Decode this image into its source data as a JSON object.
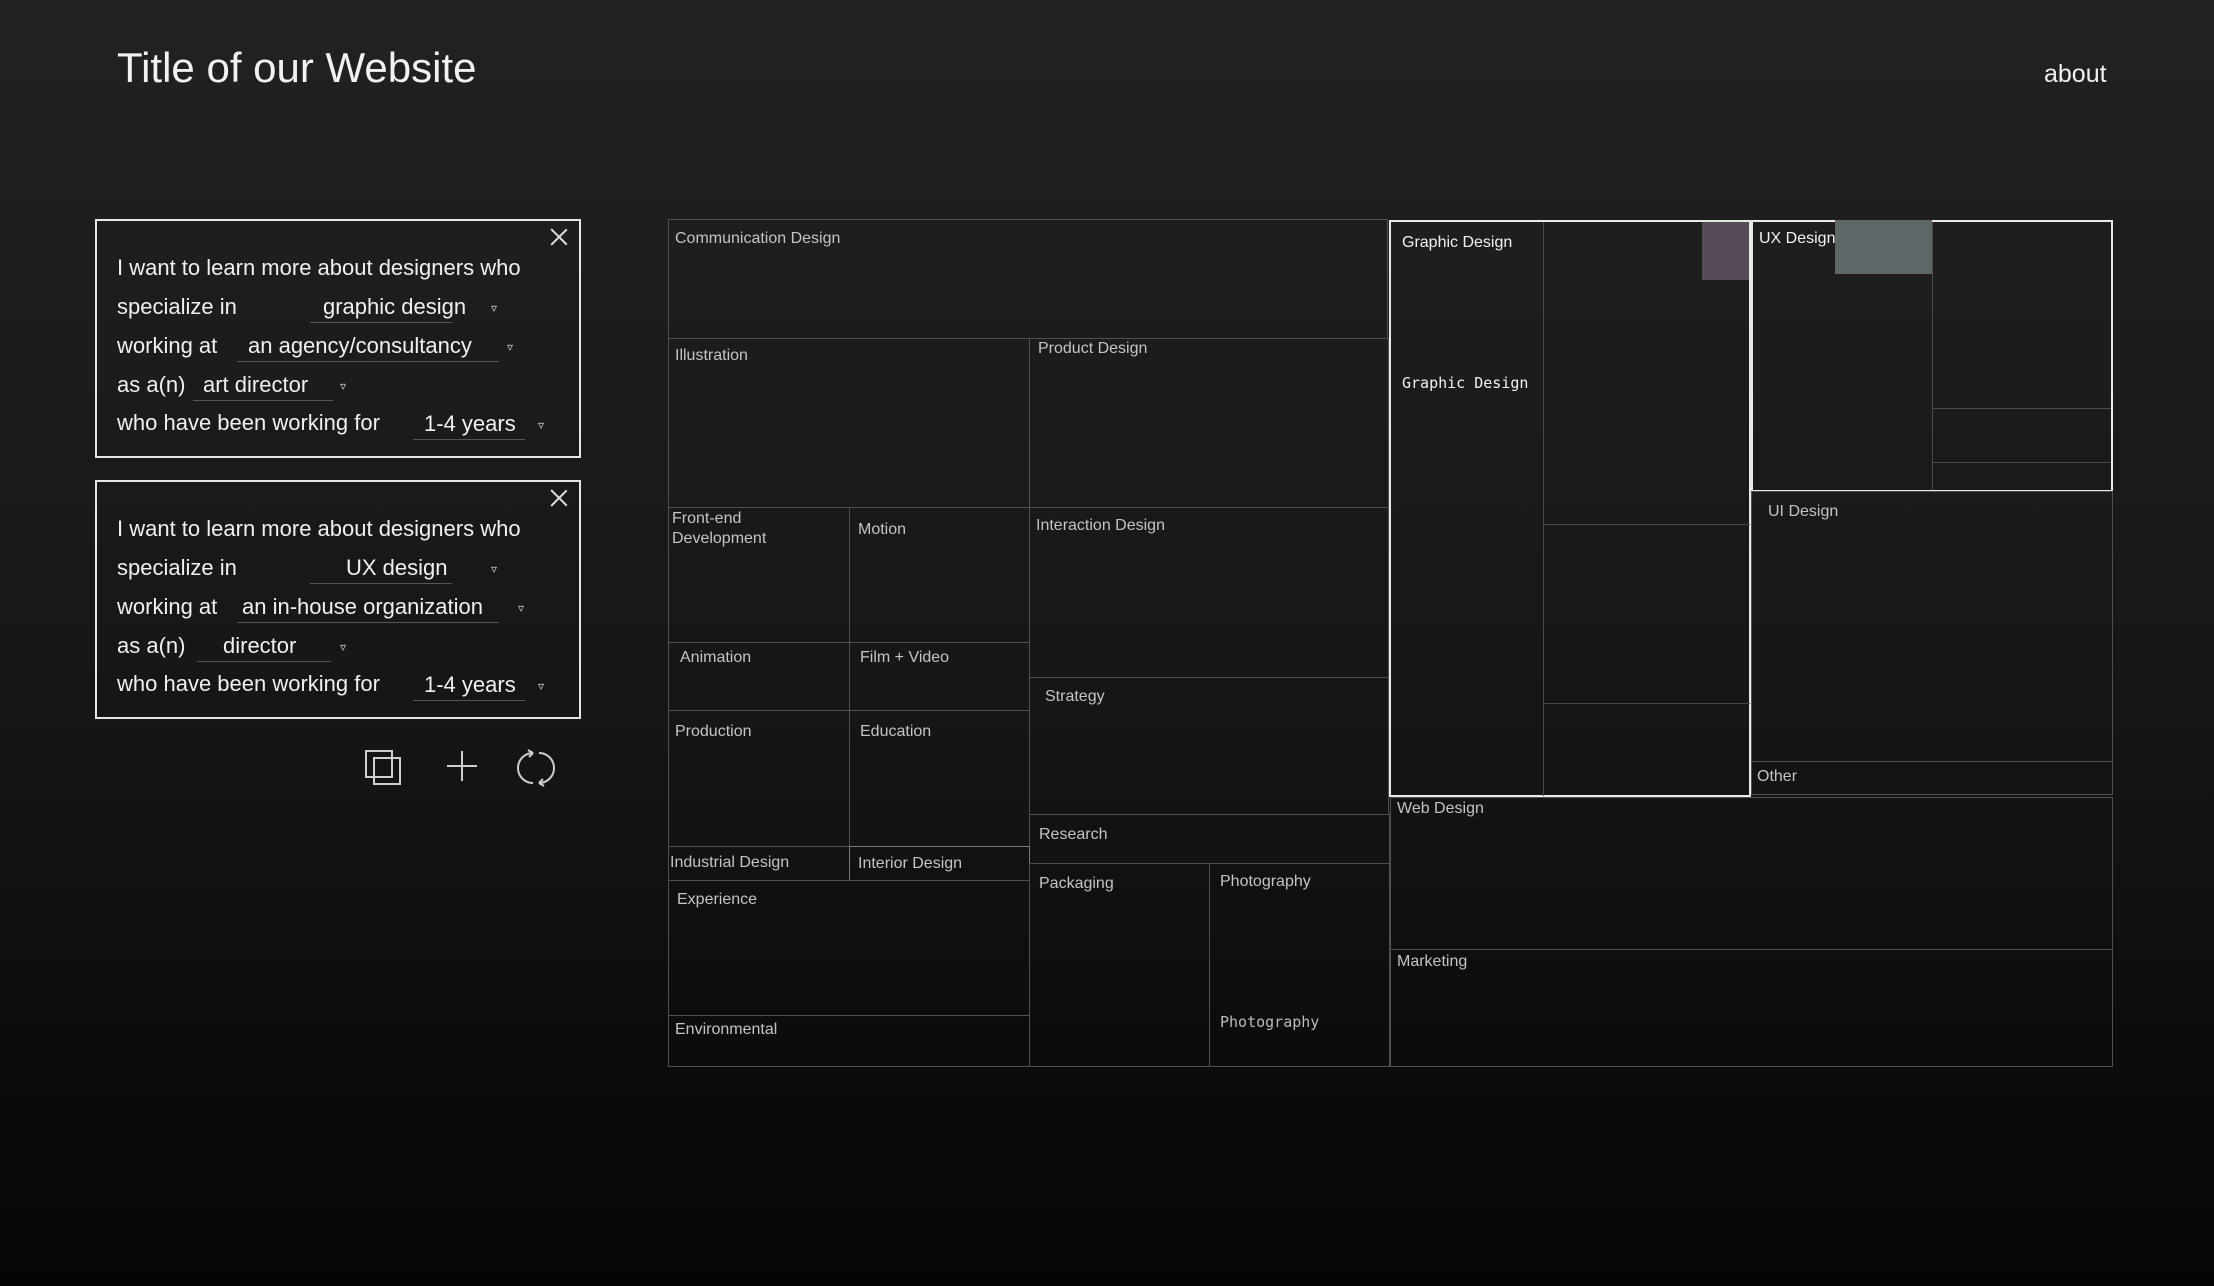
{
  "header": {
    "title": "Title of our Website",
    "about": "about"
  },
  "queries": [
    {
      "intro": "I want to learn more about designers who",
      "specialize_label": "specialize in",
      "specialty": "graphic design",
      "working_label": "working at",
      "workplace": "an agency/consultancy",
      "role_label": "as a(n)",
      "role": "art director",
      "duration_label": "who have been working for",
      "duration": "1-4 years"
    },
    {
      "intro": "I want to learn more about designers who",
      "specialize_label": "specialize in",
      "specialty": "UX design",
      "working_label": "working at",
      "workplace": "an in-house organization",
      "role_label": "as a(n)",
      "role": "director",
      "duration_label": "who have been working for",
      "duration": "1-4 years"
    }
  ],
  "dropdown_icon": "▿",
  "toolbar": {
    "icons": [
      "duplicate-icon",
      "add-icon",
      "refresh-icon"
    ]
  },
  "treemap": {
    "cells": {
      "communication_design": "Communication Design",
      "illustration": "Illustration",
      "product_design": "Product Design",
      "frontend_dev": "Front-end\nDevelopment",
      "motion": "Motion",
      "interaction_design": "Interaction Design",
      "animation": "Animation",
      "film_video": "Film + Video",
      "strategy": "Strategy",
      "production": "Production",
      "education": "Education",
      "research": "Research",
      "industrial_design": "Industrial Design",
      "interior_design": "Interior Design",
      "experience": "Experience",
      "packaging": "Packaging",
      "photography": "Photography",
      "photography_mono": "Photography",
      "environmental": "Environmental",
      "graphic_design": "Graphic Design",
      "graphic_design_mono": "Graphic Design",
      "ux_design": "UX Design",
      "ui_design": "UI Design",
      "other": "Other",
      "web_design": "Web Design",
      "marketing": "Marketing"
    },
    "colors": {
      "graphic_swatch": "#574a57",
      "ux_swatch": "#5d6767"
    }
  }
}
